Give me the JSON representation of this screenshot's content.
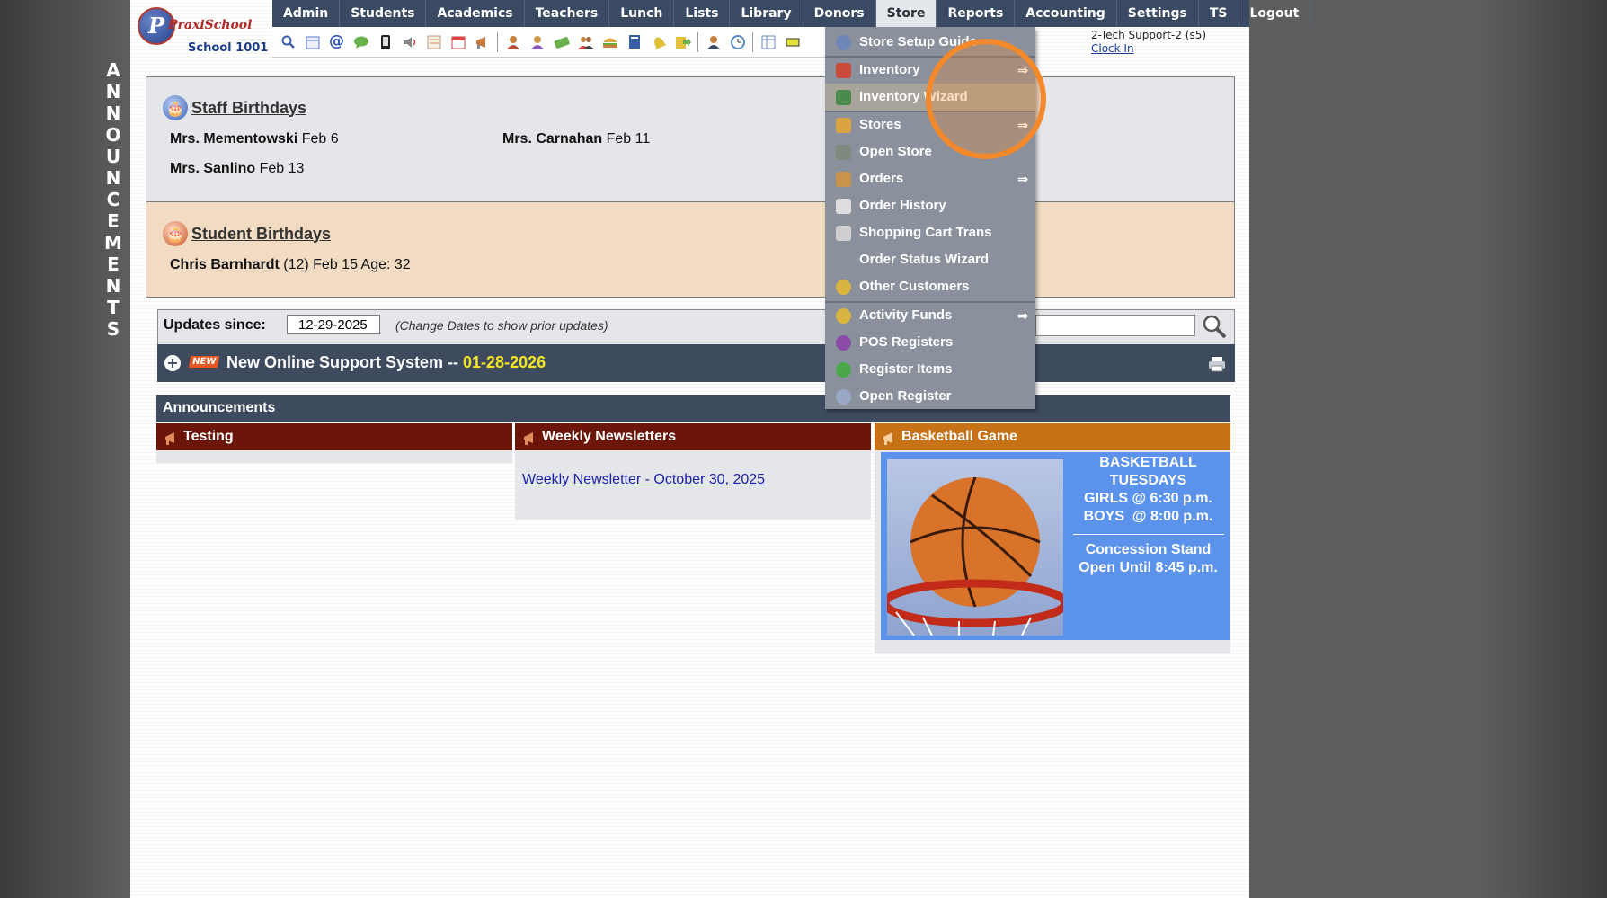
{
  "announcements_vertical": [
    "A",
    "N",
    "N",
    "O",
    "U",
    "N",
    "C",
    "E",
    "M",
    "E",
    "N",
    "T",
    "S"
  ],
  "logo": {
    "name": "PraxiSchool",
    "school": "School 1001"
  },
  "nav": [
    "Admin",
    "Students",
    "Academics",
    "Teachers",
    "Lunch",
    "Lists",
    "Library",
    "Donors",
    "Store",
    "Reports",
    "Accounting",
    "Settings",
    "TS",
    "Logout"
  ],
  "nav_active": "Store",
  "iconbar": [
    "search",
    "calendar",
    "at",
    "chat",
    "phone",
    "speaker",
    "form",
    "calendar-red",
    "megaphone",
    "person-red",
    "person-orange",
    "money",
    "people",
    "burger",
    "book",
    "bell",
    "export",
    "user-admin",
    "clock",
    "table",
    "bar"
  ],
  "user": {
    "name": "2-Tech Support-2 (s5)",
    "clock_in": "Clock In"
  },
  "staff_birthdays": {
    "title": "Staff Birthdays",
    "people": [
      {
        "name": "Mrs. Mementowski",
        "date": "Feb 6"
      },
      {
        "name": "Mrs. Carnahan",
        "date": "Feb 11"
      },
      {
        "name": "Mrs. Sanlino",
        "date": "Feb 13"
      }
    ]
  },
  "student_birthdays": {
    "title": "Student Birthdays",
    "people": [
      {
        "name": "Chris Barnhardt",
        "extra": "(12) Feb 15 Age: 32"
      }
    ]
  },
  "updates": {
    "label": "Updates since:",
    "date": "12-29-2025",
    "hint": "(Change Dates to show prior updates)"
  },
  "news": {
    "badge": "NEW",
    "title": "New Online Support System -- ",
    "date": "01-28-2026"
  },
  "announcements": {
    "title": "Announcements",
    "columns": [
      {
        "title": "Testing"
      },
      {
        "title": "Weekly Newsletters",
        "link": "Weekly Newsletter - October 30, 2025"
      },
      {
        "title": "Basketball Game"
      }
    ],
    "basketball": {
      "line1": "BASKETBALL",
      "line2": "TUESDAYS",
      "line3": "GIRLS @ 6:30 p.m.",
      "line4": "BOYS  @ 8:00 p.m.",
      "line5": "Concession Stand",
      "line6": "Open Until 8:45 p.m."
    }
  },
  "store_menu": {
    "items": [
      {
        "label": "Store Setup Guide",
        "arrow": "",
        "icon": "gear-icon",
        "color": "#6f86b8"
      },
      {
        "label": "Inventory",
        "arrow": "⇒",
        "icon": "inventory-icon",
        "color": "#c94b3a"
      },
      {
        "label": "Inventory Wizard",
        "arrow": "",
        "icon": "wizard-icon",
        "color": "#4a8a4a"
      },
      {
        "label": "Stores",
        "arrow": "⇒",
        "icon": "store-icon",
        "color": "#d9a441"
      },
      {
        "label": "Open Store",
        "arrow": "",
        "icon": "cash-icon",
        "color": "#7e8a7e"
      },
      {
        "label": "Orders",
        "arrow": "⇒",
        "icon": "box-icon",
        "color": "#c8934a"
      },
      {
        "label": "Order History",
        "arrow": "",
        "icon": "clipboard-icon",
        "color": "#dddddd"
      },
      {
        "label": "Shopping Cart Trans",
        "arrow": "",
        "icon": "cart-icon",
        "color": "#cfcfcf"
      },
      {
        "label": "Order Status Wizard",
        "arrow": "",
        "icon": "",
        "color": ""
      },
      {
        "label": "Other Customers",
        "arrow": "",
        "icon": "person-icon",
        "color": "#d9b441"
      },
      {
        "label": "Activity Funds",
        "arrow": "⇒",
        "icon": "coins-icon",
        "color": "#d9b441"
      },
      {
        "label": "POS Registers",
        "arrow": "",
        "icon": "register-icon",
        "color": "#8a4aa8"
      },
      {
        "label": "Register Items",
        "arrow": "",
        "icon": "list-icon",
        "color": "#4aa84a"
      },
      {
        "label": "Open Register",
        "arrow": "",
        "icon": "open-register-icon",
        "color": "#9aa8c8"
      }
    ],
    "highlighted": "Inventory Wizard"
  }
}
